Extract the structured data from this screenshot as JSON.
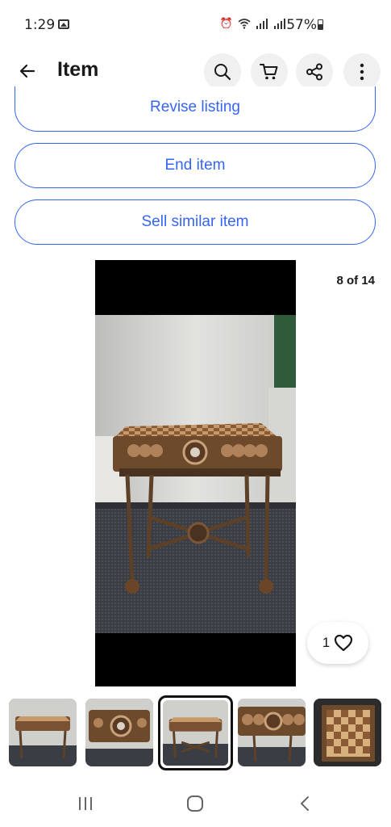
{
  "status": {
    "time": "1:29",
    "battery": "57%",
    "icons": [
      "photo-icon",
      "alarm-icon",
      "wifi-icon",
      "signal-icon",
      "signal-icon",
      "battery-icon"
    ]
  },
  "header": {
    "title": "Item",
    "icons": [
      "back-arrow-icon",
      "search-icon",
      "cart-icon",
      "share-icon",
      "more-vertical-icon"
    ]
  },
  "actions": {
    "revise": "Revise listing",
    "end": "End item",
    "similar": "Sell similar item"
  },
  "gallery": {
    "counter": "8 of 14",
    "watch_count": "1",
    "thumbnail_count": 5,
    "selected_thumbnail": 3
  },
  "colors": {
    "accent": "#3665f3",
    "text": "#191919",
    "header_button_bg": "#f0f0f0"
  },
  "nav": {
    "icons": [
      "recent-apps-icon",
      "home-icon",
      "back-icon"
    ]
  }
}
